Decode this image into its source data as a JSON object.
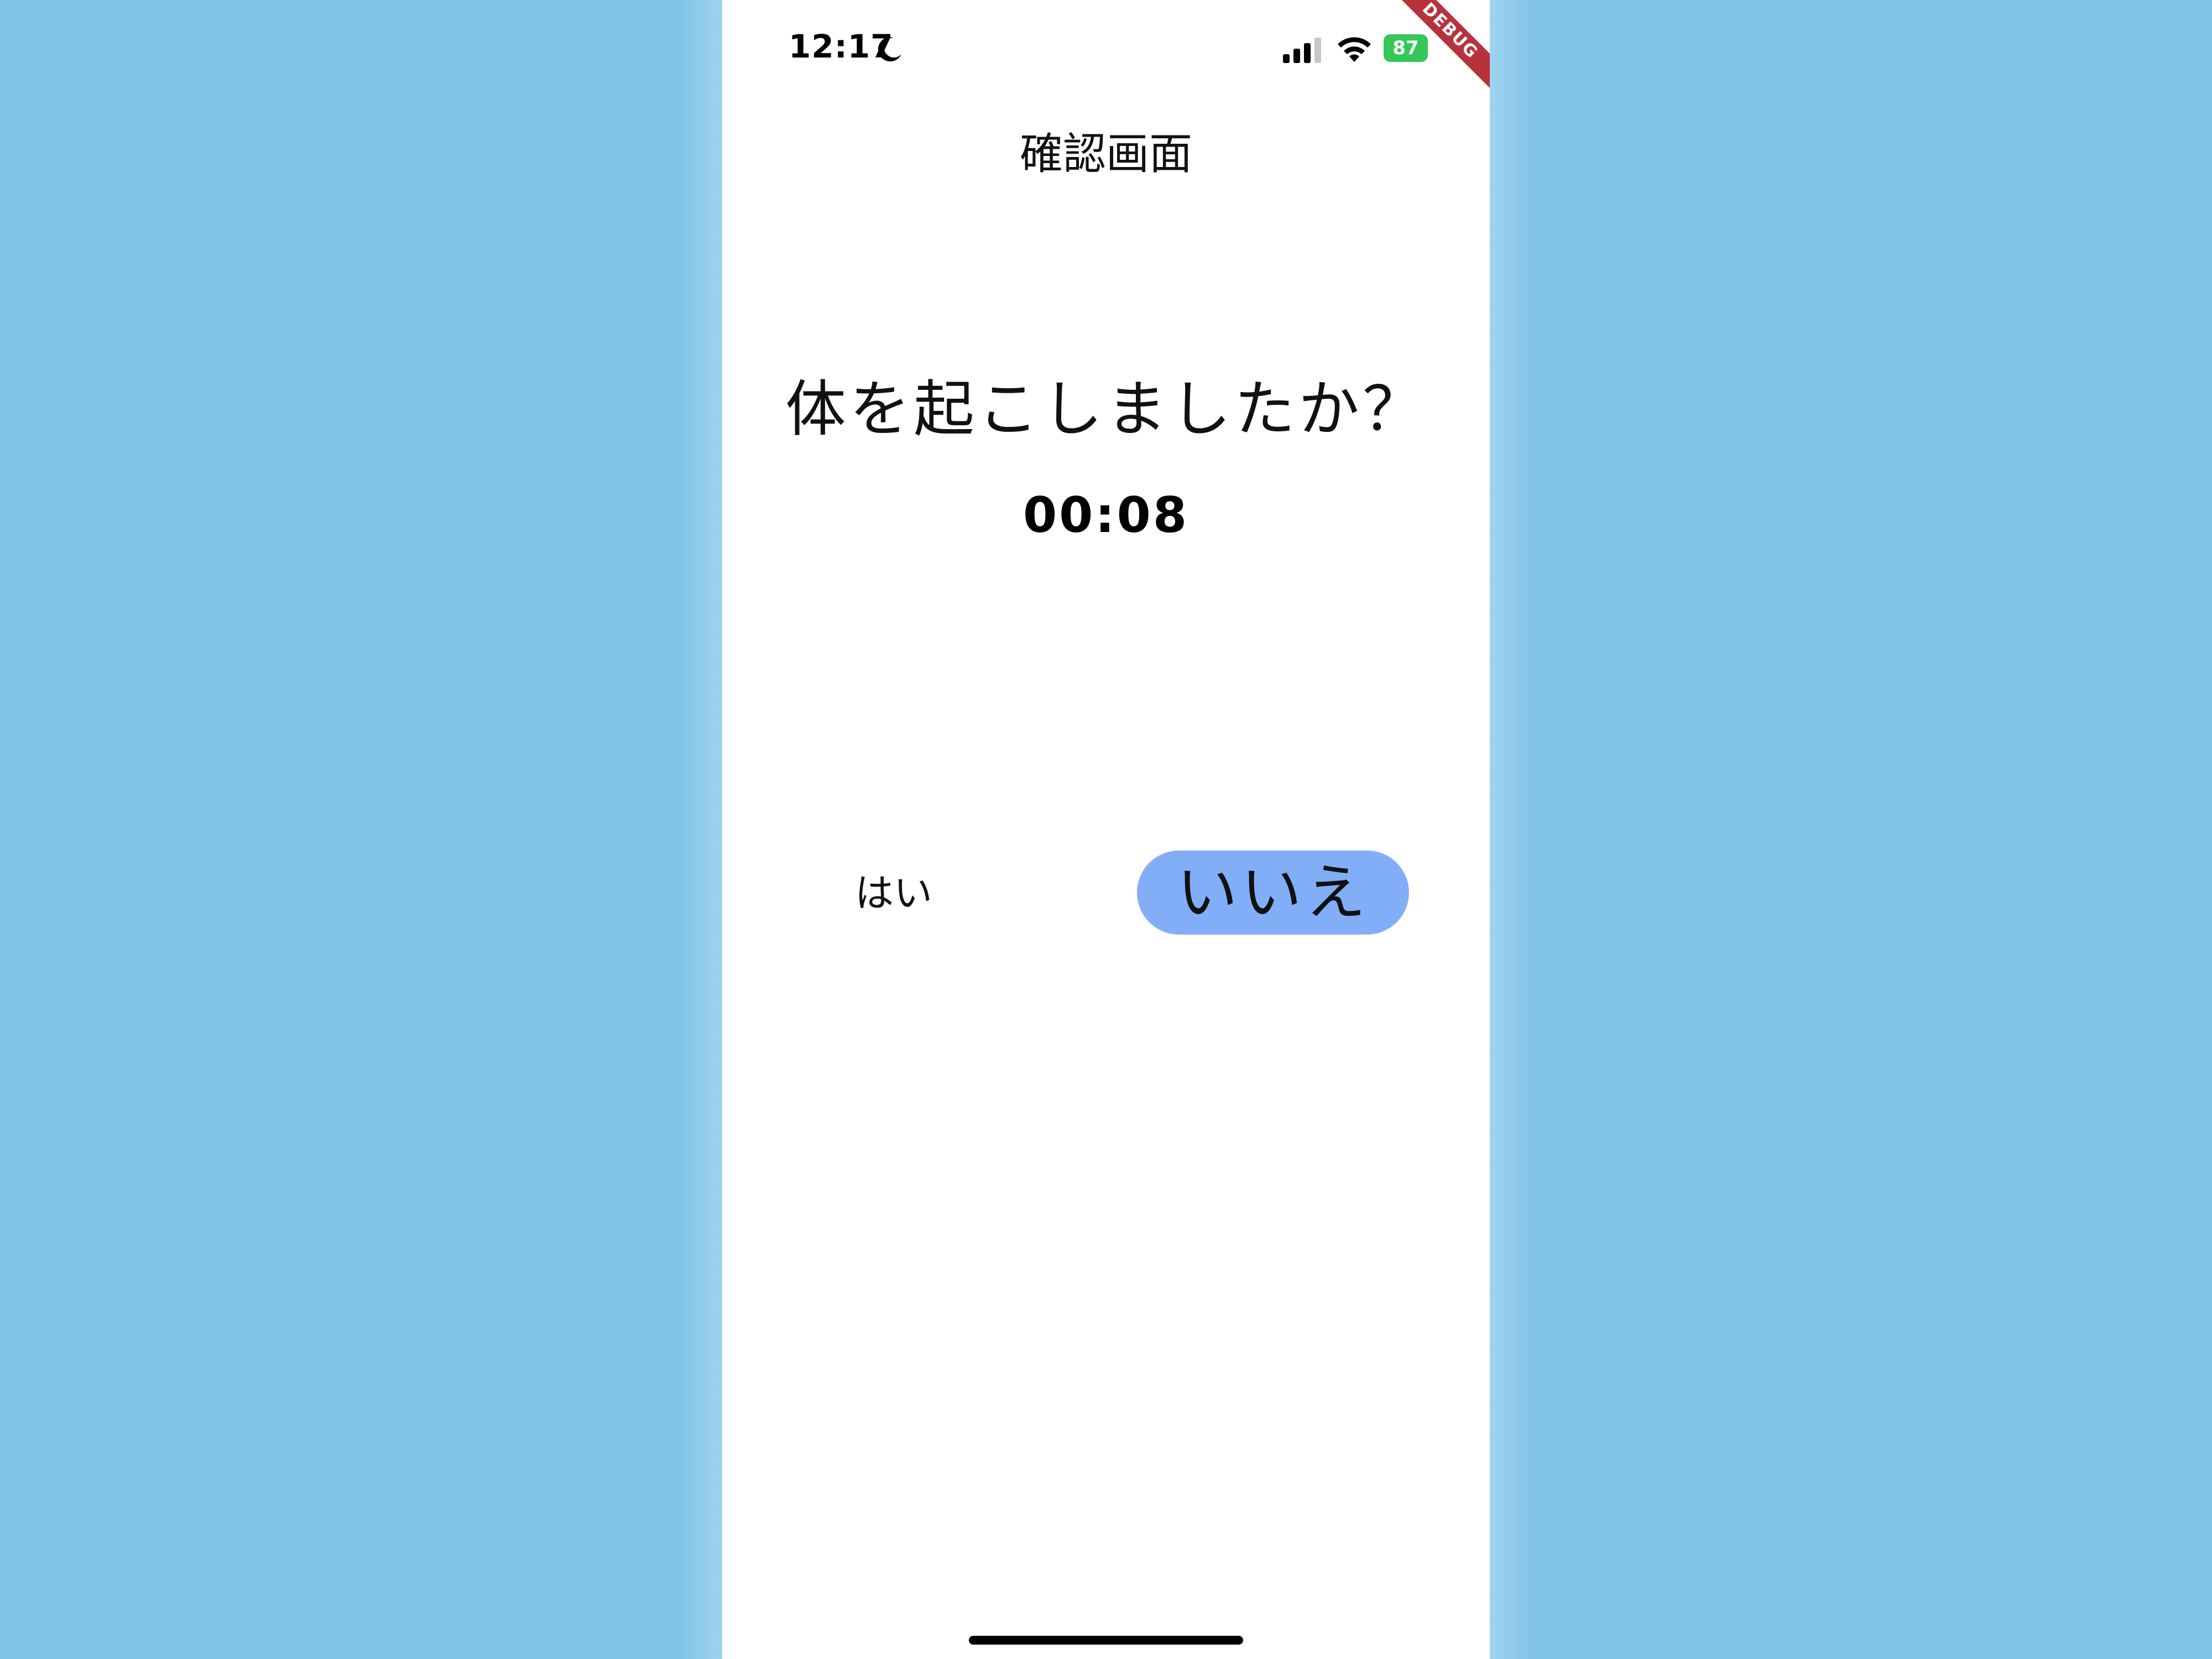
{
  "status_bar": {
    "time": "12:17",
    "battery_percent": "87",
    "icons": [
      "moon-icon",
      "signal-icon",
      "wifi-icon",
      "battery-icon"
    ]
  },
  "debug_banner": "DEBUG",
  "app_bar": {
    "title": "確認画面"
  },
  "main": {
    "question": "体を起こしましたか？",
    "timer": "00:08"
  },
  "buttons": {
    "yes_label": "はい",
    "no_label": "いいえ"
  },
  "colors": {
    "background": "#82c4e8",
    "no_button": "#82aef8",
    "battery": "#34c759",
    "debug_banner": "#b8323c"
  }
}
